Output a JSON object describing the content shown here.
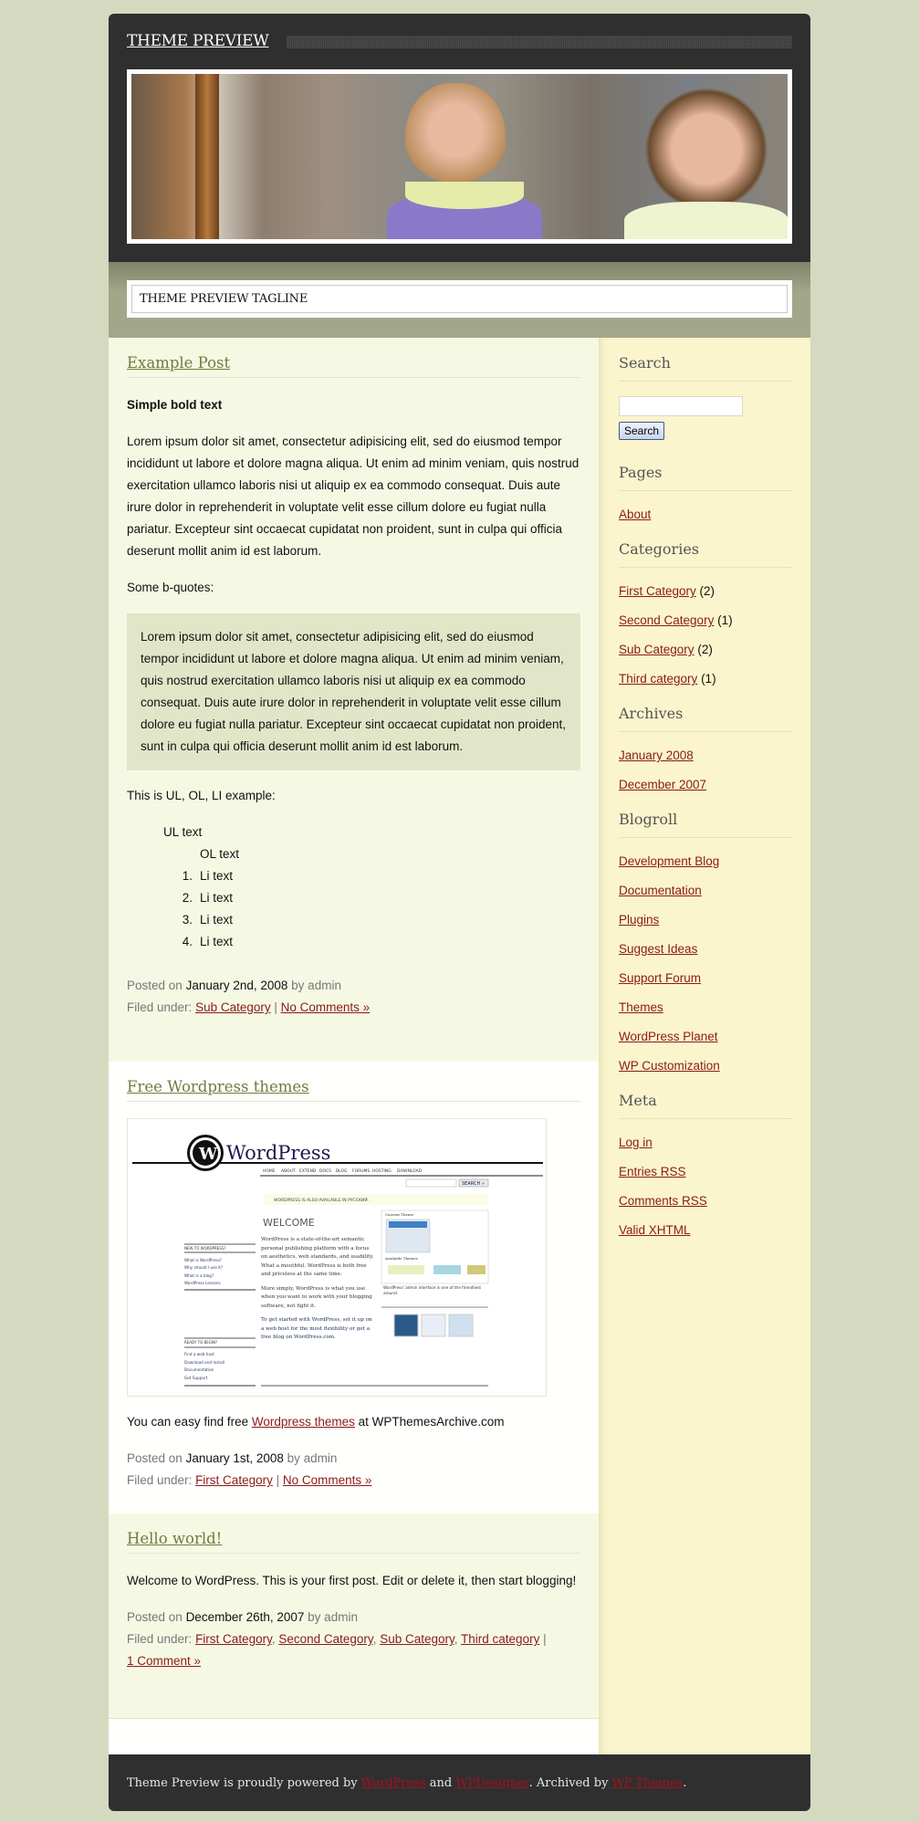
{
  "header": {
    "site_title": "THEME PREVIEW",
    "tagline": "THEME PREVIEW TAGLINE",
    "banner_alt": "header-photo-two-children-eating-melon"
  },
  "posts": [
    {
      "title": "Example Post",
      "bold_text": "Simple bold text",
      "paragraph": "Lorem ipsum dolor sit amet, consectetur adipisicing elit, sed do eiusmod tempor incididunt ut labore et dolore magna aliqua. Ut enim ad minim veniam, quis nostrud exercitation ullamco laboris nisi ut aliquip ex ea commodo consequat. Duis aute irure dolor in reprehenderit in voluptate velit esse cillum dolore eu fugiat nulla pariatur. Excepteur sint occaecat cupidatat non proident, sunt in culpa qui officia deserunt mollit anim id est laborum.",
      "bquote_intro": "Some b-quotes:",
      "blockquote": "Lorem ipsum dolor sit amet, consectetur adipisicing elit, sed do eiusmod tempor incididunt ut labore et dolore magna aliqua. Ut enim ad minim veniam, quis nostrud exercitation ullamco laboris nisi ut aliquip ex ea commodo consequat. Duis aute irure dolor in reprehenderit in voluptate velit esse cillum dolore eu fugiat nulla pariatur. Excepteur sint occaecat cupidatat non proident, sunt in culpa qui officia deserunt mollit anim id est laborum.",
      "list_intro": "This is UL, OL, LI example:",
      "ul_text": "UL text",
      "ol_text": "OL text",
      "li_items": [
        {
          "num": "1.",
          "text": "Li text"
        },
        {
          "num": "2.",
          "text": "Li text"
        },
        {
          "num": "3.",
          "text": "Li text"
        },
        {
          "num": "4.",
          "text": "Li text"
        }
      ],
      "posted_on_label": "Posted on",
      "date": "January 2nd, 2008",
      "by_label": "by admin",
      "filed_label": "Filed under:",
      "categories": [
        "Sub Category"
      ],
      "comments": "No Comments »"
    },
    {
      "title": "Free Wordpress themes",
      "image_text": {
        "logo": "WordPress",
        "nav": [
          "HOME",
          "ABOUT",
          "EXTEND",
          "DOCS",
          "BLOG",
          "FORUMS",
          "HOSTING",
          "DOWNLOAD"
        ],
        "search_btn": "SEARCH »",
        "notice": "WORDPRESS IS ALSO AVAILABLE IN РУССКИЙ.",
        "welcome": "WELCOME",
        "new_heading": "NEW TO WORDPRESS?",
        "new_links": [
          "What is WordPress?",
          "Why should I use it?",
          "What is a blog?",
          "WordPress Lessons"
        ],
        "ready_heading": "READY TO BEGIN?",
        "ready_links": [
          "Find a web host",
          "Download and Install",
          "Documentation",
          "Get Support"
        ],
        "body1": "WordPress is a state-of-the-art semantic personal publishing platform with a focus on aesthetics, web standards, and usability. What a mouthful. WordPress is both free and priceless at the same time.",
        "body2": "More simply, WordPress is what you use when you want to work with your blogging software, not fight it.",
        "body3": "To get started with WordPress, set it up on a web host for the most flexibility or get a free blog on WordPress.com.",
        "current_theme": "Current Theme",
        "available_themes": "Available Themes",
        "caption": "WordPress' admin interface is one of the friendliest around."
      },
      "text_before": "You can easy find free ",
      "link": "Wordpress themes",
      "text_after": " at WPThemesArchive.com",
      "posted_on_label": "Posted on",
      "date": "January 1st, 2008",
      "by_label": "by admin",
      "filed_label": "Filed under:",
      "categories": [
        "First Category"
      ],
      "comments": "No Comments »"
    },
    {
      "title": "Hello world!",
      "paragraph": "Welcome to WordPress. This is your first post. Edit or delete it, then start blogging!",
      "posted_on_label": "Posted on",
      "date": "December 26th, 2007",
      "by_label": "by admin",
      "filed_label": "Filed under:",
      "categories": [
        "First Category",
        "Second Category",
        "Sub Category",
        "Third category"
      ],
      "comments": "1 Comment »"
    }
  ],
  "sidebar": {
    "search": {
      "title": "Search",
      "input_value": "",
      "button": "Search"
    },
    "pages": {
      "title": "Pages",
      "items": [
        "About"
      ]
    },
    "categories": {
      "title": "Categories",
      "items": [
        {
          "label": "First Category",
          "count": "(2)"
        },
        {
          "label": "Second Category",
          "count": "(1)"
        },
        {
          "label": "Sub Category",
          "count": "(2)"
        },
        {
          "label": "Third category",
          "count": "(1)"
        }
      ]
    },
    "archives": {
      "title": "Archives",
      "items": [
        "January 2008",
        "December 2007"
      ]
    },
    "blogroll": {
      "title": "Blogroll",
      "items": [
        "Development Blog",
        "Documentation",
        "Plugins",
        "Suggest Ideas",
        "Support Forum",
        "Themes",
        "WordPress Planet",
        "WP Customization"
      ]
    },
    "meta": {
      "title": "Meta",
      "items": [
        "Log in",
        "Entries RSS",
        "Comments RSS",
        "Valid XHTML"
      ]
    }
  },
  "footer": {
    "text1": "Theme Preview is proudly powered by ",
    "link1": "WordPress",
    "text2": " and ",
    "link2": "WPDesigner",
    "text3": ". Archived by ",
    "link3": "WP Themes",
    "text4": "."
  },
  "colors": {
    "page_bg": "#d4d9c0",
    "header_bg": "#2f2f2f",
    "link": "#8b1a1a",
    "post_title": "#737a3e",
    "sidebar_bg": "#fbf5cd",
    "blockquote_bg": "#e2e6c8"
  }
}
